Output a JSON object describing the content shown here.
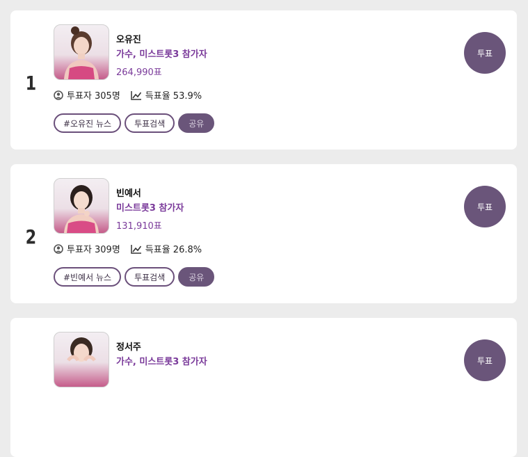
{
  "entries": [
    {
      "rank": "1",
      "name": "오유진",
      "role": "가수, 미스트롯3 참가자",
      "votes": "264,990표",
      "voters": "투표자 305명",
      "rate": "득표율 53.9%",
      "tags": [
        "#오유진 뉴스",
        "투표검색"
      ],
      "share_label": "공유",
      "vote_label": "투표"
    },
    {
      "rank": "2",
      "name": "빈예서",
      "role": "미스트롯3 참가자",
      "votes": "131,910표",
      "voters": "투표자 309명",
      "rate": "득표율 26.8%",
      "tags": [
        "#빈예서 뉴스",
        "투표검색"
      ],
      "share_label": "공유",
      "vote_label": "투표"
    },
    {
      "name": "정서주",
      "role": "가수, 미스트롯3 참가자",
      "vote_label": "투표"
    }
  ],
  "icons": {
    "voters": "person-circle-icon",
    "rate": "trending-up-icon"
  },
  "colors": {
    "accent": "#6a557a",
    "role_text": "#7a3a9a",
    "background": "#ececec"
  }
}
